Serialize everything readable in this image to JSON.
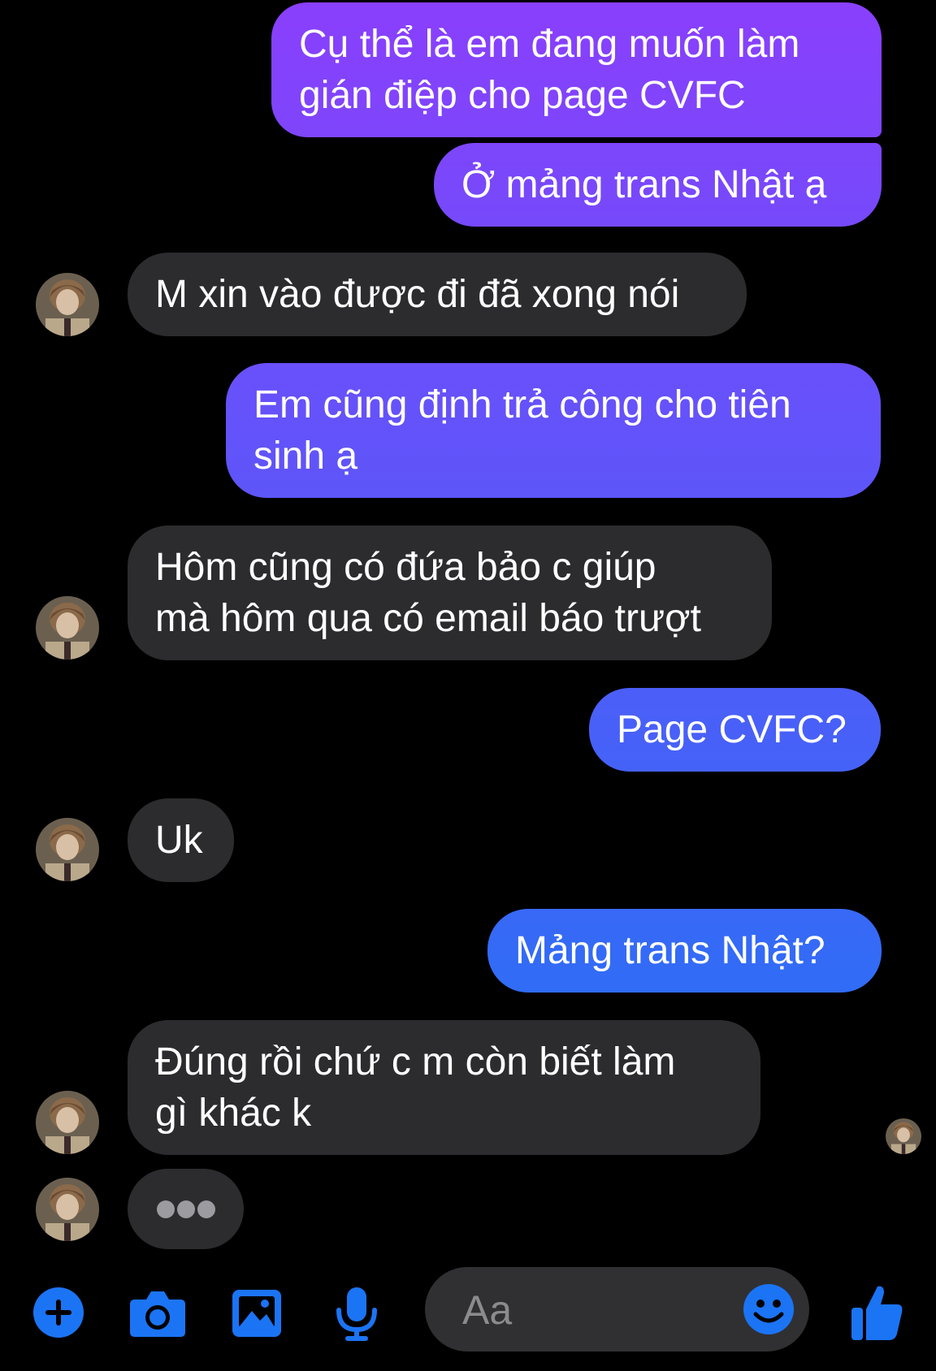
{
  "colors": {
    "background": "#000000",
    "incoming_bubble": "#2c2c2e",
    "outgoing_gradient_top": "#8a3ffc",
    "outgoing_gradient_bottom": "#2f6df6",
    "accent_blue": "#1b74f4",
    "typing_dots": "#9b9ba0"
  },
  "messages": [
    {
      "id": "m1",
      "direction": "outgoing",
      "lines": [
        "Cụ thể là em đang muốn làm",
        "gián điệp cho page CVFC"
      ]
    },
    {
      "id": "m2",
      "direction": "outgoing",
      "lines": [
        "Ở mảng trans Nhật ạ"
      ]
    },
    {
      "id": "m3",
      "direction": "incoming",
      "lines": [
        "M xin vào được đi đã xong nói"
      ]
    },
    {
      "id": "m4",
      "direction": "outgoing",
      "lines": [
        "Em cũng định trả công cho tiên",
        "sinh ạ"
      ]
    },
    {
      "id": "m5",
      "direction": "incoming",
      "lines": [
        "Hôm cũng có đứa bảo c giúp",
        "mà hôm qua có email báo trượt"
      ]
    },
    {
      "id": "m6",
      "direction": "outgoing",
      "lines": [
        "Page CVFC?"
      ]
    },
    {
      "id": "m7",
      "direction": "incoming",
      "lines": [
        "Uk"
      ]
    },
    {
      "id": "m8",
      "direction": "outgoing",
      "lines": [
        "Mảng trans Nhật?"
      ]
    },
    {
      "id": "m9",
      "direction": "incoming",
      "lines": [
        "Đúng rồi chứ c m còn biết làm",
        "gì khác k"
      ]
    }
  ],
  "typing_indicator": {
    "visible": true
  },
  "toolbar": {
    "icons": [
      "plus-icon",
      "camera-icon",
      "gallery-icon",
      "microphone-icon",
      "emoji-icon",
      "thumbs-up-icon"
    ],
    "input_placeholder": "Aa"
  }
}
